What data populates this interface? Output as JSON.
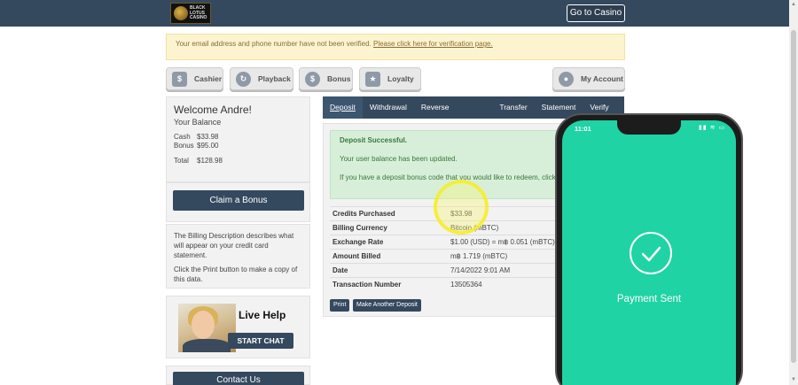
{
  "header": {
    "logo_text": "BLACK LOTUS CASINO",
    "go_to_casino": "Go to Casino"
  },
  "alert": {
    "text": "Your email address and phone number have not been verified.",
    "link": "Please click here for verification page."
  },
  "nav": {
    "cashier": "Cashier",
    "playback": "Playback",
    "bonus": "Bonus",
    "loyalty": "Loyalty",
    "account": "My Account"
  },
  "welcome": {
    "title": "Welcome Andre!",
    "subtitle": "Your Balance",
    "cash_label": "Cash",
    "cash_value": "$33.98",
    "bonus_label": "Bonus",
    "bonus_value": "$95.00",
    "total_label": "Total",
    "total_value": "$128.98"
  },
  "claim_bonus": "Claim a Bonus",
  "billing": {
    "desc": "The Billing Description describes what will appear on your credit card statement.",
    "print_hint": "Click the Print button to make a copy of this data."
  },
  "livehelp": {
    "title": "Live Help",
    "button": "START CHAT"
  },
  "contact_us": "Contact Us",
  "tabs": [
    "Deposit",
    "Withdrawal",
    "Reverse Withdrawal",
    "Transfer",
    "Statement",
    "Verify ID"
  ],
  "success": {
    "title": "Deposit Successful.",
    "line1": "Your user balance has been updated.",
    "line2": "If you have a deposit bonus code that you would like to redeem, click h"
  },
  "details": [
    {
      "label": "Credits Purchased",
      "value": "$33.98"
    },
    {
      "label": "Billing Currency",
      "value": "Bitcoin (mBTC)"
    },
    {
      "label": "Exchange Rate",
      "value": "$1.00 (USD) = m฿ 0.051 (mBTC)"
    },
    {
      "label": "Amount Billed",
      "value": "m฿ 1.719 (mBTC)"
    },
    {
      "label": "Date",
      "value": "7/14/2022 9:01 AM"
    },
    {
      "label": "Transaction Number",
      "value": "13505364"
    }
  ],
  "buttons": {
    "print": "Print",
    "another": "Make Another Deposit"
  },
  "phone": {
    "time": "11:01",
    "message": "Payment Sent"
  },
  "colors": {
    "topbar": "#34495e",
    "phone_screen": "#1fd3a4",
    "highlight": "#f5ec28"
  }
}
